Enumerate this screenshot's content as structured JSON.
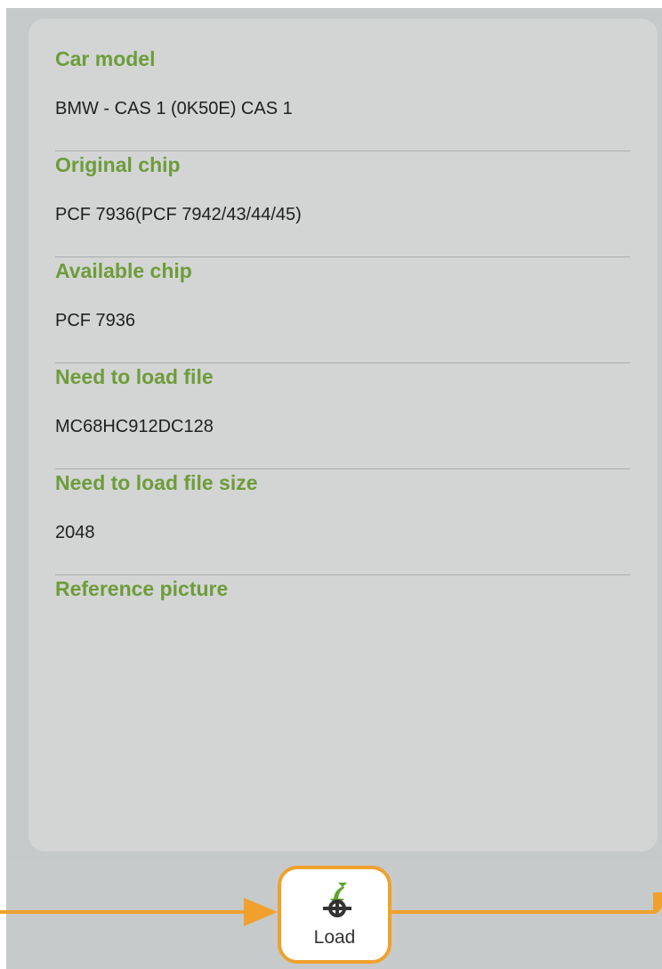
{
  "details": [
    {
      "label": "Car model",
      "value": "BMW - CAS 1 (0K50E) CAS 1"
    },
    {
      "label": "Original chip",
      "value": "PCF 7936(PCF 7942/43/44/45)"
    },
    {
      "label": "Available chip",
      "value": "PCF 7936"
    },
    {
      "label": "Need to load file",
      "value": "MC68HC912DC128"
    },
    {
      "label": "Need to load file size",
      "value": "2048"
    }
  ],
  "reference_picture_label": "Reference picture",
  "actions": {
    "load_label": "Load",
    "load_icon": "load-gear-icon"
  },
  "colors": {
    "label_green": "#6e9c3a",
    "accent_orange": "#f0a12d"
  }
}
